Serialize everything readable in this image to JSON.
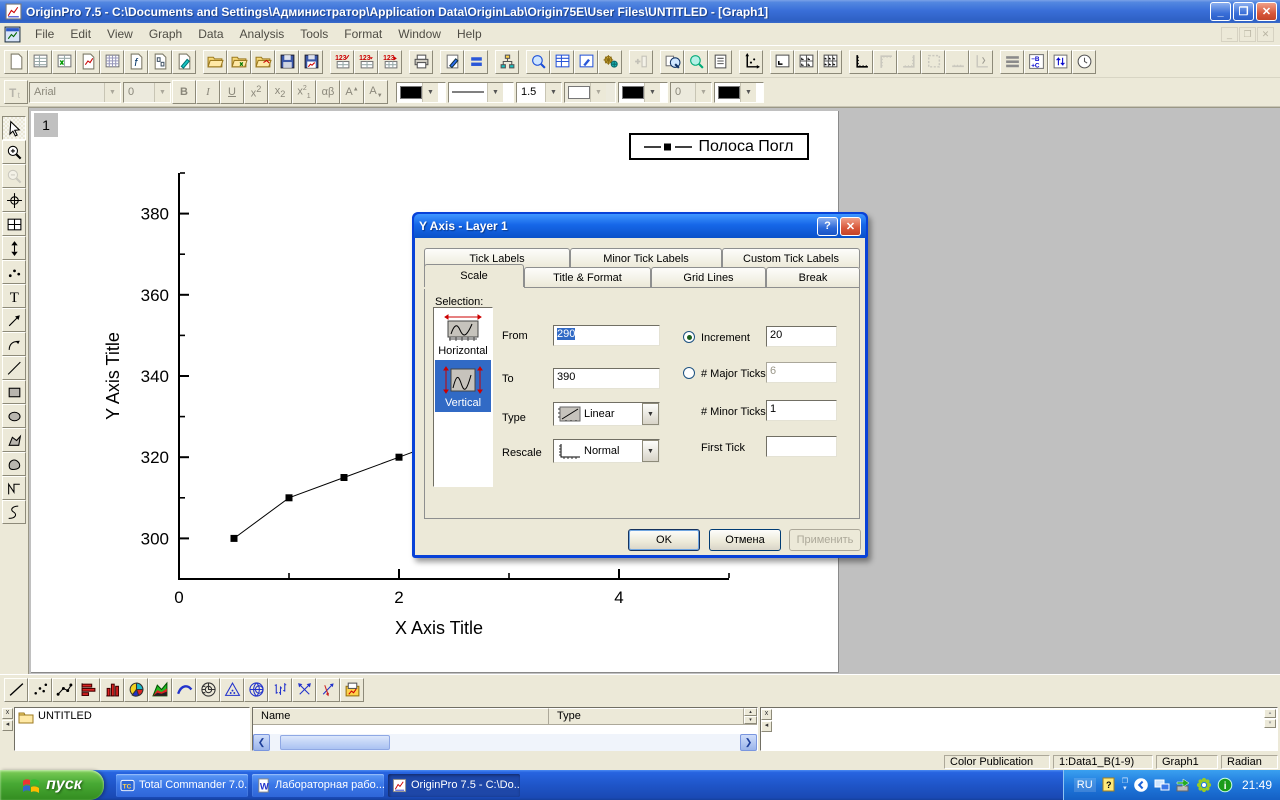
{
  "titlebar": {
    "title": "OriginPro 7.5 - C:\\Documents and Settings\\Администратор\\Application Data\\OriginLab\\Origin75E\\User Files\\UNTITLED - [Graph1]"
  },
  "menubar": {
    "items": [
      "File",
      "Edit",
      "View",
      "Graph",
      "Data",
      "Analysis",
      "Tools",
      "Format",
      "Window",
      "Help"
    ]
  },
  "toolbar_standard": [
    {
      "name": "new-project"
    },
    {
      "name": "new-worksheet"
    },
    {
      "name": "new-excel"
    },
    {
      "name": "new-graph"
    },
    {
      "name": "new-matrix"
    },
    {
      "name": "new-function"
    },
    {
      "name": "new-layout"
    },
    {
      "name": "new-notes"
    },
    {
      "sep": true
    },
    {
      "name": "open"
    },
    {
      "name": "open-excel"
    },
    {
      "name": "open-template"
    },
    {
      "name": "save-project"
    },
    {
      "name": "save-template"
    },
    {
      "sep": true
    },
    {
      "name": "import-ascii"
    },
    {
      "name": "import-multiple-ascii"
    },
    {
      "name": "import-wizard"
    },
    {
      "sep": true
    },
    {
      "name": "print"
    },
    {
      "sep": true
    },
    {
      "name": "draft-view"
    },
    {
      "name": "format-display"
    },
    {
      "sep": true
    },
    {
      "name": "project-organizer"
    },
    {
      "sep": true
    },
    {
      "name": "zoom-tool"
    },
    {
      "name": "worksheet-display"
    },
    {
      "name": "script-window"
    },
    {
      "name": "code-builder"
    },
    {
      "sep": true
    },
    {
      "name": "add-column",
      "disabled": true
    },
    {
      "sep": true
    },
    {
      "name": "duplicate-with-zoom"
    },
    {
      "name": "zoom-whole-page"
    },
    {
      "name": "full-menus"
    },
    {
      "sep": true
    },
    {
      "name": "rescale-axes"
    },
    {
      "sep": true
    },
    {
      "name": "add-layer"
    },
    {
      "name": "add-4-layers"
    },
    {
      "name": "add-9-layers"
    },
    {
      "sep": true
    },
    {
      "name": "bottom-left-axes"
    },
    {
      "name": "top-axes",
      "disabled": true
    },
    {
      "name": "right-axes",
      "disabled": true
    },
    {
      "name": "box-axes",
      "disabled": true
    },
    {
      "name": "bottom-only-axes",
      "disabled": true
    },
    {
      "name": "axis-special",
      "disabled": true
    },
    {
      "sep": true
    },
    {
      "name": "legend-lines"
    },
    {
      "name": "b-c-operation"
    },
    {
      "name": "exchange-columns"
    },
    {
      "name": "date-time"
    }
  ],
  "toolbar_format": {
    "font_name": "Arial",
    "font_size": "0",
    "style_buttons": [
      "bold",
      "italic",
      "underline",
      "superscript",
      "subscript",
      "super-subscript",
      "greek",
      "increase-font",
      "decrease-font"
    ],
    "line_color": "#000000",
    "line_width": "1.5",
    "fill_color": "#ffffff",
    "symbol_color": "#000000",
    "pattern_width": "0",
    "pattern_color": "#000000"
  },
  "tools_palette": [
    {
      "name": "pointer",
      "selected": true
    },
    {
      "name": "zoom-in"
    },
    {
      "name": "zoom-out",
      "disabled": true
    },
    {
      "name": "screen-reader"
    },
    {
      "name": "data-display"
    },
    {
      "name": "data-selector"
    },
    {
      "name": "draw-data"
    },
    {
      "name": "text-tool"
    },
    {
      "name": "arrow-tool"
    },
    {
      "name": "curved-arrow"
    },
    {
      "name": "line-tool"
    },
    {
      "name": "rectangle-tool"
    },
    {
      "name": "ellipse-tool"
    },
    {
      "name": "polygon-tool"
    },
    {
      "name": "region-tool"
    },
    {
      "name": "polyline-tool"
    },
    {
      "name": "freehand-tool"
    }
  ],
  "graph": {
    "layer_badge": "1",
    "legend": {
      "label": "Полоса Погл"
    }
  },
  "chart_data": {
    "type": "line",
    "series": [
      {
        "name": "Полоса Погл",
        "marker": "filled-square",
        "x": [
          0.5,
          1.0,
          1.5,
          2.0
        ],
        "y": [
          300,
          310,
          315,
          320
        ]
      }
    ],
    "visible_line_end": {
      "x": 2.4,
      "y": 324
    },
    "title": "",
    "xlabel": "X Axis Title",
    "ylabel": "Y Axis Title",
    "xlim": [
      0,
      5
    ],
    "ylim": [
      290,
      390
    ],
    "x_major_ticks": [
      0,
      2,
      4
    ],
    "x_minor_ticks": [
      1,
      3,
      5
    ],
    "y_major_ticks": [
      300,
      320,
      340,
      360,
      380
    ],
    "y_minor_ticks": [
      310,
      330,
      350,
      370,
      390
    ],
    "grid": false,
    "legend_position": "top-right"
  },
  "dialog": {
    "title": "Y Axis - Layer 1",
    "tabs_row1": [
      "Tick Labels",
      "Minor Tick Labels",
      "Custom Tick Labels"
    ],
    "tabs_row2": [
      "Scale",
      "Title & Format",
      "Grid Lines",
      "Break"
    ],
    "active_tab": "Scale",
    "selection_label": "Selection:",
    "selection_items": [
      {
        "label": "Horizontal",
        "selected": false
      },
      {
        "label": "Vertical",
        "selected": true
      }
    ],
    "fields": {
      "from_label": "From",
      "from_value": "290",
      "to_label": "To",
      "to_value": "390",
      "type_label": "Type",
      "type_value": "Linear",
      "rescale_label": "Rescale",
      "rescale_value": "Normal"
    },
    "right": {
      "increment_label": "Increment",
      "increment_value": "20",
      "increment_selected": true,
      "major_label": "# Major Ticks",
      "major_value": "6",
      "major_selected": false,
      "minor_label": "# Minor Ticks",
      "minor_value": "1",
      "first_tick_label": "First Tick",
      "first_tick_value": ""
    },
    "buttons": {
      "ok": "OK",
      "cancel": "Отмена",
      "apply": "Применить"
    }
  },
  "toolbar_2d": [
    {
      "name": "line-plot"
    },
    {
      "name": "scatter-plot"
    },
    {
      "name": "line-symbol-plot"
    },
    {
      "name": "bar-plot"
    },
    {
      "name": "column-plot"
    },
    {
      "name": "pie-chart"
    },
    {
      "name": "area-plot"
    },
    {
      "name": "spline-plot"
    },
    {
      "name": "polar-plot"
    },
    {
      "name": "ternary-plot"
    },
    {
      "name": "smith-chart"
    },
    {
      "name": "stock-plot"
    },
    {
      "name": "vector-xyxy"
    },
    {
      "name": "vector-xyam"
    },
    {
      "name": "template-library"
    }
  ],
  "project_explorer": {
    "folder": "UNTITLED",
    "columns": [
      "Name",
      "Type"
    ]
  },
  "status_bar": {
    "cells": [
      "Color Publication",
      "1:Data1_B(1-9)",
      "Graph1",
      "Radian"
    ]
  },
  "taskbar": {
    "start": "пуск",
    "tasks": [
      {
        "label": "Total Commander 7.0...",
        "icon": "total-commander-icon",
        "active": false
      },
      {
        "label": "Лабораторная рабо...",
        "icon": "word-doc-icon",
        "active": false
      },
      {
        "label": "OriginPro 7.5 - C:\\Do...",
        "icon": "origin-app-icon",
        "active": true
      }
    ],
    "tray": {
      "lang": "RU",
      "icons": [
        "keyboard-help-icon",
        "network-icon",
        "removable-media-icon",
        "icq-icon",
        "info-icon"
      ],
      "clock": "21:49"
    }
  }
}
